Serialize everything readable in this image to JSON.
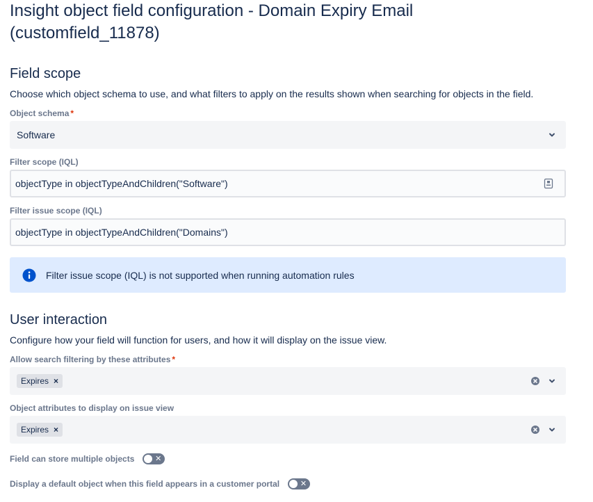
{
  "page": {
    "title": "Insight object field configuration - Domain Expiry Email (customfield_11878)"
  },
  "field_scope": {
    "heading": "Field scope",
    "description": "Choose which object schema to use, and what filters to apply on the results shown when searching for objects in the field.",
    "object_schema": {
      "label": "Object schema",
      "required_mark": "*",
      "value": "Software"
    },
    "filter_scope": {
      "label": "Filter scope (IQL)",
      "value": "objectType in objectTypeAndChildren(\"Software\")"
    },
    "filter_issue_scope": {
      "label": "Filter issue scope (IQL)",
      "value": "objectType in objectTypeAndChildren(\"Domains\")"
    },
    "info_banner": {
      "icon": "info-icon",
      "text": "Filter issue scope (IQL) is not supported when running automation rules"
    }
  },
  "user_interaction": {
    "heading": "User interaction",
    "description": "Configure how your field will function for users, and how it will display on the issue view.",
    "search_filtering": {
      "label": "Allow search filtering by these attributes",
      "required_mark": "*",
      "tags": [
        "Expires"
      ]
    },
    "display_attributes": {
      "label": "Object attributes to display on issue view",
      "tags": [
        "Expires"
      ]
    },
    "multiple_objects": {
      "label": "Field can store multiple objects",
      "toggle_glyph": "✕",
      "enabled": false
    },
    "default_object": {
      "label": "Display a default object when this field appears in a customer portal",
      "toggle_glyph": "✕",
      "enabled": false
    }
  },
  "colors": {
    "text": "#172b4d",
    "label": "#6b778c",
    "required": "#de350b",
    "info_bg": "#deebff",
    "info_icon": "#0052cc",
    "select_bg": "#f4f5f7",
    "toggle_off": "#6b778c"
  }
}
